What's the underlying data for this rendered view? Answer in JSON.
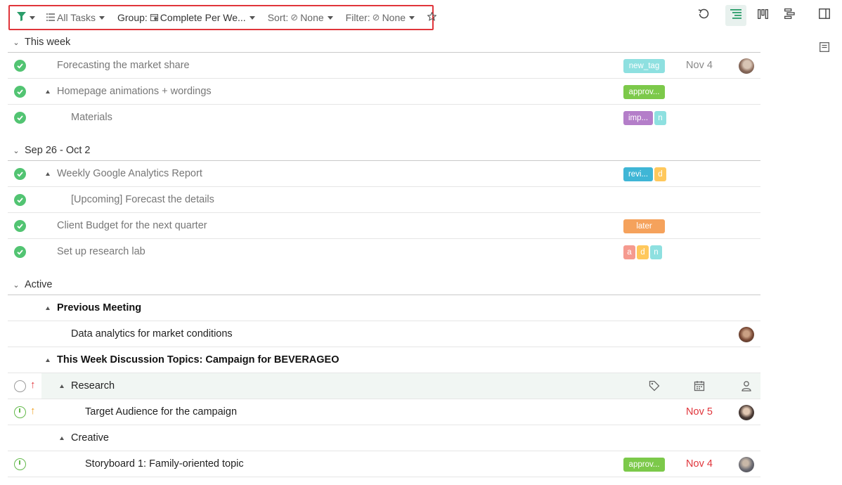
{
  "toolbar": {
    "all_tasks": "All Tasks",
    "group": "Group:",
    "group_value": "Complete Per We...",
    "sort": "Sort:",
    "sort_value": "None",
    "filter": "Filter:",
    "filter_value": "None"
  },
  "colors": {
    "accent_green": "#2a9d6a",
    "check_green": "#52c472",
    "highlight_border": "#e0353b",
    "overdue_red": "#e0353b"
  },
  "groups": [
    {
      "label": "This week",
      "rows": [
        {
          "title": "Forecasting the market share",
          "tags": [
            {
              "text": "new_tag",
              "color": "#8ee0e0"
            }
          ],
          "date": "Nov 4",
          "avatar": true
        },
        {
          "title": "Homepage animations + wordings",
          "expandable": true,
          "tags": [
            {
              "text": "approv...",
              "color": "#7cc94a"
            }
          ]
        },
        {
          "title": "Materials",
          "indent": 1,
          "tags": [
            {
              "text": "imp...",
              "color": "#b47ec9"
            },
            {
              "text": "n",
              "color": "#8ee0e0"
            }
          ]
        }
      ]
    },
    {
      "label": "Sep 26 - Oct 2",
      "rows": [
        {
          "title": "Weekly Google Analytics Report",
          "expandable": true,
          "tags": [
            {
              "text": "revi...",
              "color": "#3fb6d6"
            },
            {
              "text": "d",
              "color": "#ffc85c"
            }
          ]
        },
        {
          "title": "[Upcoming] Forecast the details",
          "indent": 1
        },
        {
          "title": "Client Budget for the next quarter",
          "tags": [
            {
              "text": "later",
              "color": "#f5a25c"
            }
          ]
        },
        {
          "title": "Set up research lab",
          "tags": [
            {
              "text": "a",
              "color": "#f59a8f"
            },
            {
              "text": "d",
              "color": "#ffc85c"
            },
            {
              "text": "n",
              "color": "#8ee0e0"
            }
          ]
        }
      ]
    },
    {
      "label": "Active",
      "rows": [
        {
          "title": "Previous Meeting"
        },
        {
          "title": "Data analytics for market conditions"
        },
        {
          "title": "This Week Discussion Topics: Campaign for BEVERAGEO"
        },
        {
          "title": "Research"
        },
        {
          "title": "Target Audience for the campaign",
          "date": "Nov 5"
        },
        {
          "title": "Creative"
        },
        {
          "title": "Storyboard 1: Family-oriented topic",
          "tags": [
            {
              "text": "approv...",
              "color": "#7cc94a"
            }
          ],
          "date": "Nov 4"
        }
      ]
    }
  ]
}
